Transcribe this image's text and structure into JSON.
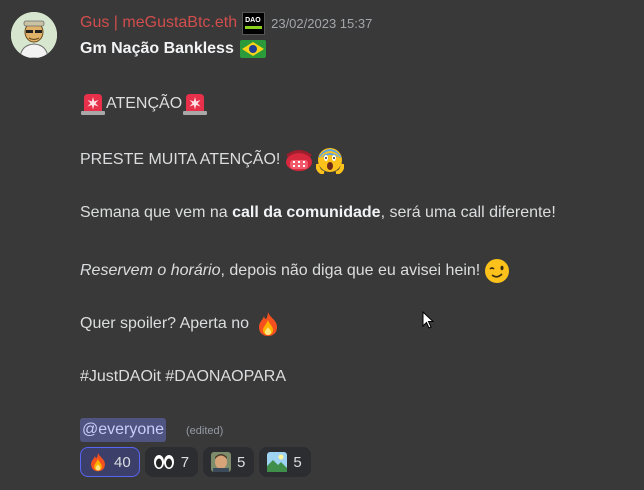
{
  "message": {
    "username": "Gus | meGustaBtc.eth",
    "badge_text": "DAO",
    "timestamp": "23/02/2023 15:37",
    "lines": {
      "greeting": "Gm Nação Bankless",
      "attention": "ATENÇÃO",
      "preste": "PRESTE MUITA ATENÇÃO!",
      "semana_pre": "Semana que vem na ",
      "semana_bold": "call da comunidade",
      "semana_post": ", será uma call diferente!",
      "reservem_italic": "Reservem o horário",
      "reservem_post": ", depois não diga que eu avisei hein!",
      "spoiler": "Quer spoiler? Aperta no",
      "hashtags": "#JustDAOit #DAONAOPARA"
    },
    "mention": "@everyone",
    "edited": "(edited)"
  },
  "reactions": [
    {
      "emoji": "fire-icon",
      "count": "40"
    },
    {
      "emoji": "eyes-icon",
      "count": "7"
    },
    {
      "emoji": "face-avatar-icon",
      "count": "5"
    },
    {
      "emoji": "landscape-icon",
      "count": "5"
    }
  ],
  "colors": {
    "background": "#393939",
    "username": "#d24d4d",
    "mention_bg": "#4f5481",
    "reaction_active": "#5865f2"
  }
}
